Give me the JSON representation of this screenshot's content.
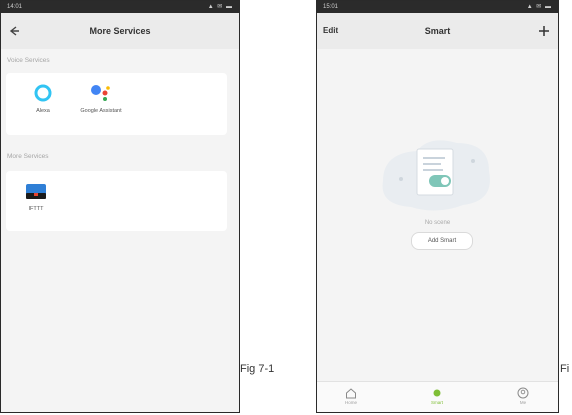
{
  "screen1": {
    "status_bar": {
      "time": "14:01",
      "icons": "▲ ✉ ▬"
    },
    "title": "More Services",
    "sections": [
      {
        "label": "Voice Services",
        "items": [
          {
            "label": "Alexa",
            "icon": "alexa-icon"
          },
          {
            "label": "Google Assistant",
            "icon": "google-assistant-icon"
          }
        ]
      },
      {
        "label": "More Services",
        "items": [
          {
            "label": "IFTTT",
            "icon": "ifttt-icon"
          }
        ]
      }
    ],
    "caption": "Fig 7-1"
  },
  "screen2": {
    "status_bar": {
      "time": "15:01",
      "icons": "▲ ✉ ▬"
    },
    "edit_label": "Edit",
    "title": "Smart",
    "empty_text": "No scene",
    "add_button": "Add Smart",
    "tabs": [
      {
        "label": "Home",
        "icon": "home-icon",
        "active": false
      },
      {
        "label": "Smart",
        "icon": "smart-icon",
        "active": true
      },
      {
        "label": "Me",
        "icon": "profile-icon",
        "active": false
      }
    ],
    "caption": "Fi"
  },
  "colors": {
    "accent_green": "#7fbf36",
    "status_bar": "#2b2b2b",
    "background": "#f4f4f4"
  }
}
